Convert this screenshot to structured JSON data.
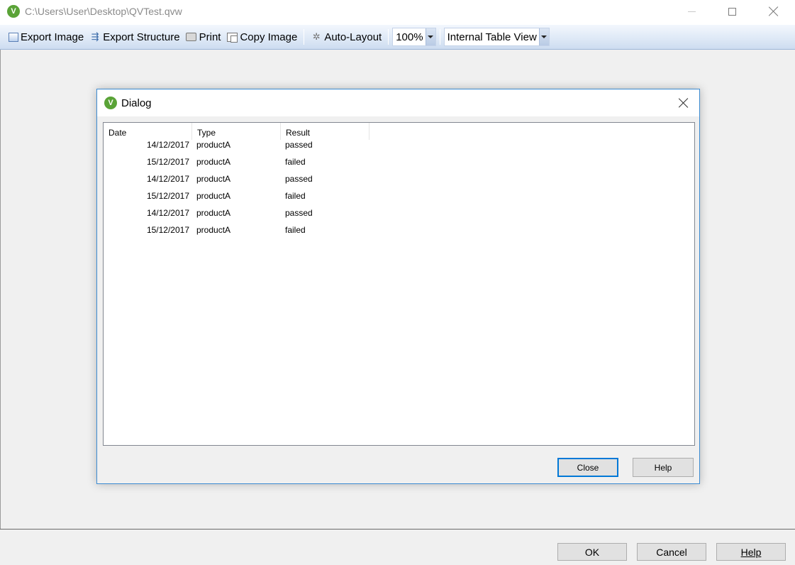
{
  "window": {
    "logo_text": "V",
    "title": "C:\\Users\\User\\Desktop\\QVTest.qvw"
  },
  "toolbar": {
    "export_image_label": "Export Image",
    "export_structure_label": "Export Structure",
    "print_label": "Print",
    "copy_image_label": "Copy Image",
    "auto_layout_label": "Auto-Layout",
    "zoom_value": "100%",
    "view_value": "Internal Table View"
  },
  "dialog": {
    "logo_text": "V",
    "title": "Dialog",
    "columns": [
      "Date",
      "Type",
      "Result"
    ],
    "rows": [
      {
        "date": "14/12/2017",
        "type": "productA",
        "result": "passed"
      },
      {
        "date": "15/12/2017",
        "type": "productA",
        "result": "failed"
      },
      {
        "date": "14/12/2017",
        "type": "productA",
        "result": "passed"
      },
      {
        "date": "15/12/2017",
        "type": "productA",
        "result": "failed"
      },
      {
        "date": "14/12/2017",
        "type": "productA",
        "result": "passed"
      },
      {
        "date": "15/12/2017",
        "type": "productA",
        "result": "failed"
      }
    ],
    "close_label": "Close",
    "help_label": "Help"
  },
  "footer": {
    "ok_label": "OK",
    "cancel_label": "Cancel",
    "help_label": "Help"
  },
  "colors": {
    "accent": "#0078d7",
    "logo_green": "#5aa337",
    "toolbar_top": "#f3f7fd",
    "toolbar_bottom": "#cddcf0"
  }
}
